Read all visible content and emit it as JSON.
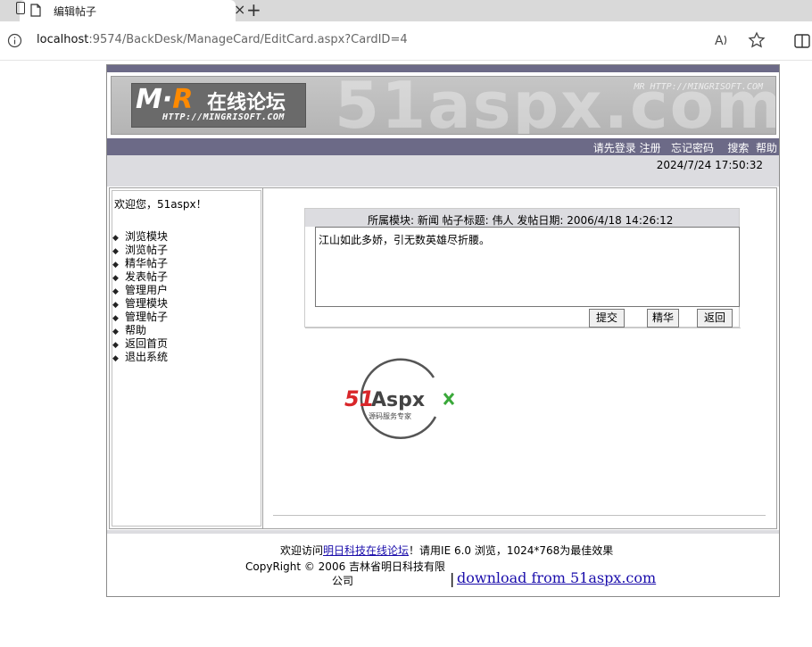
{
  "browser": {
    "tab_title": "编辑帖子",
    "tab_close": "×",
    "new_tab": "+",
    "url_host": "localhost",
    "url_rest": ":9574/BackDesk/ManageCard/EditCard.aspx?CardID=4"
  },
  "banner": {
    "watermark": "51aspx.com",
    "small_url": "MR HTTP://MINGRISOFT.COM",
    "logo_mr_m": "M·",
    "logo_mr_r": "R",
    "logo_cn": "在线论坛",
    "logo_url": "HTTP://MINGRISOFT.COM"
  },
  "nav": {
    "login": "请先登录",
    "register": "注册",
    "forgot": "忘记密码",
    "search": "搜索",
    "help": "帮助"
  },
  "datetime": "2024/7/24 17:50:32",
  "sidebar": {
    "welcome": "欢迎您，51aspx！",
    "bullet": "◆",
    "items": [
      {
        "label": "浏览模块"
      },
      {
        "label": "浏览帖子"
      },
      {
        "label": "精华帖子"
      },
      {
        "label": "发表帖子"
      },
      {
        "label": "管理用户"
      },
      {
        "label": "管理模块"
      },
      {
        "label": "管理帖子"
      },
      {
        "label": "帮助"
      },
      {
        "label": "返回首页"
      },
      {
        "label": "退出系统"
      }
    ]
  },
  "form": {
    "header": "所属模块: 新闻 帖子标题: 伟人 发帖日期: 2006/4/18 14:26:12",
    "content": "江山如此多娇，引无数英雄尽折腰。",
    "submit": "提交",
    "essence": "精华",
    "back": "返回"
  },
  "badge": {
    "text_51": "51",
    "text_aspx": "Aspx",
    "subtitle": "源码服务专家"
  },
  "footer": {
    "line1_prefix": "欢迎访问",
    "line1_link": "明日科技在线论坛",
    "line1_suffix": "！请用IE 6.0 浏览，1024*768为最佳效果",
    "line2": "CopyRight © 2006 吉林省明日科技有限",
    "line3": "公司",
    "pipe": "|",
    "download": "download from 51aspx.com"
  }
}
